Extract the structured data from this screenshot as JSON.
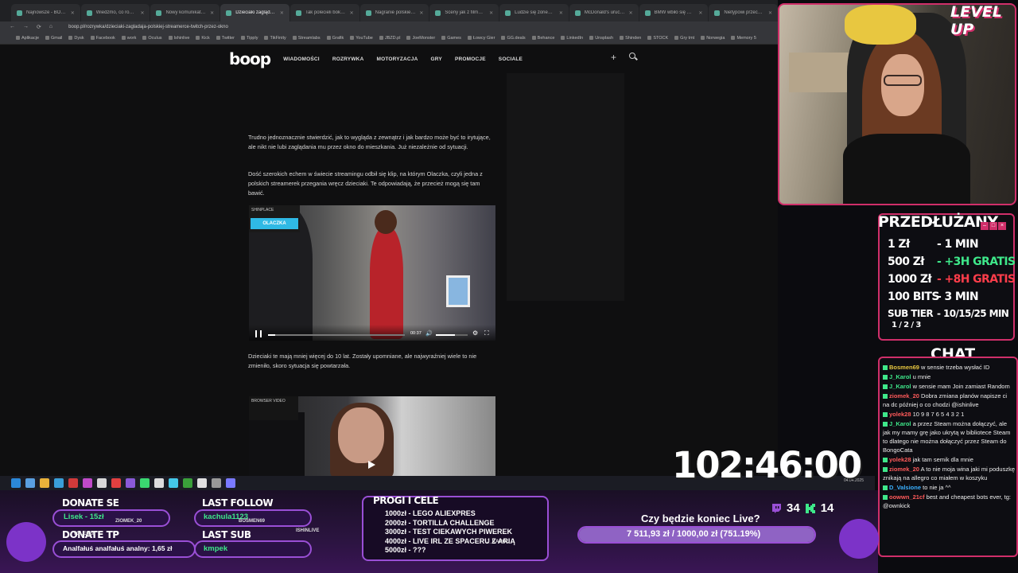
{
  "browser": {
    "tabs": [
      {
        "label": "Najnowsze - BOOP.PL",
        "active": false
      },
      {
        "label": "Wiedzmo, co robi prokuratura",
        "active": false
      },
      {
        "label": "Nowy komunikat prokuratury",
        "active": false
      },
      {
        "label": "Dzieciaki zaglądają przez okno",
        "active": true
      },
      {
        "label": "Tak polecieli bokiem, że",
        "active": false
      },
      {
        "label": "Nagranie polskiego influ",
        "active": false
      },
      {
        "label": "Sceny jak z filmu akcji w",
        "active": false
      },
      {
        "label": "Ludzie się zorientowali, że",
        "active": false
      },
      {
        "label": "McDonald's uruchomił ",
        "active": false
      },
      {
        "label": "BMW wbiło się w drzewo",
        "active": false
      },
      {
        "label": "Nietypowi przechodnie",
        "active": false
      }
    ],
    "url": "boop.pl/rozrywka/dzieciaki-zagladaja-polskiej-streamerce-twitch-przez-okno",
    "bookmarks": [
      "Aplikacje",
      "Gmail",
      "Dysk",
      "Facebook",
      "work",
      "Oculus",
      "Ishinlive",
      "Kick",
      "Twitter",
      "Tipply",
      "TikFinity",
      "Streamlabs",
      "Grafik",
      "YouTube",
      "JBZD.pl",
      "JoeMonster",
      "Games",
      "Łowcy Gier",
      "GG.deals",
      "Behance",
      "LinkedIn",
      "Unsplash",
      "Shinden",
      "STOCK",
      "Gry tmt",
      "Norwegia",
      "Memory 5"
    ]
  },
  "site": {
    "logo": "boop",
    "nav": [
      "WIADOMOŚCI",
      "ROZRYWKA",
      "MOTORYZACJA",
      "GRY",
      "PROMOCJE",
      "SOCIALE"
    ],
    "paragraphs": [
      "Trudno jednoznacznie stwierdzić, jak to wygląda z zewnątrz i jak bardzo może być to irytujące, ale nikt nie lubi zaglądania mu przez okno do mieszkania. Już niezależnie od sytuacji.",
      "Dość szerokich echem w świecie streamingu odbił się klip, na którym Olaczka, czyli jedna z polskich streamerek przegania wręcz dzieciaki. Te odpowiadają, że przecież mogą się tam bawić.",
      "Dzieciaki te mają mniej więcej do 10 lat. Zostały upomniane, ale najwyraźniej wiele to nie zmieniło, skoro sytuacja się powtarzała."
    ],
    "video1": {
      "badge_top": "SHINPLACE",
      "badge_label": "OLACZKA",
      "time": "00:37",
      "progress": 0.05,
      "volume": 0.6
    },
    "video2": {
      "badge_top": "BROWSER VIDEO"
    }
  },
  "overlay": {
    "brand": "LEVEL UP",
    "prices": {
      "title": "PRZEDŁUŻANY",
      "rows": [
        {
          "amount": "1 Zł",
          "value": "- 1 MIN",
          "color": "#ffffff"
        },
        {
          "amount": "500 Zł",
          "value": "- +3H GRATIS",
          "color": "#3ee88a"
        },
        {
          "amount": "1000 Zł",
          "value": "- +8H GRATIS",
          "color": "#ff3d4a"
        },
        {
          "amount": "100 BITS",
          "value": "- 3 MIN",
          "color": "#ffffff"
        },
        {
          "amount": "SUB TIER",
          "value": "- 10/15/25 MIN",
          "color": "#ffffff"
        }
      ],
      "tier_sub": "1 / 2 / 3"
    },
    "chat": {
      "title": "CHAT",
      "messages": [
        {
          "user": "Bosmen69",
          "color": "#e8c740",
          "text": " w sensie trzeba wysłać ID"
        },
        {
          "user": "J_Karol",
          "color": "#3ee88a",
          "text": " u mnie"
        },
        {
          "user": "J_Karol",
          "color": "#3ee88a",
          "text": " w sensie mam Join zamiast Random"
        },
        {
          "user": "ziomek_20",
          "color": "#ff5a5a",
          "text": " Dobra zmiana planów napisze ci na dc później o co chodzi @ishinlive"
        },
        {
          "user": "yolek28",
          "color": "#ff5a5a",
          "text": " 10 9 8 7 6 5 4 3 2 1"
        },
        {
          "user": "J_Karol",
          "color": "#3ee88a",
          "text": " a przez Steam można dołączyć, ale jak my mamy grę jako ukrytą w bibliotece Steam to dlatego nie można dołączyć przez Steam do BongoCata"
        },
        {
          "user": "yolek28",
          "color": "#ff5a5a",
          "text": " jak tam semik dla mnie"
        },
        {
          "user": "ziomek_20",
          "color": "#ff5a5a",
          "text": " A to nie moja wina jaki mi poduszkę znikają na allegro co miałem w koszyku"
        },
        {
          "user": "D_Valsione",
          "color": "#3ab0ff",
          "text": " to nie ja ^^"
        },
        {
          "user": "oowwn_21cf",
          "color": "#ff5a5a",
          "text": " best and cheapest bots ever, tg: @ownkick"
        }
      ]
    },
    "timer": "102:46:00",
    "donate_se": {
      "title": "DONATE SE",
      "name": "Lisek - 15zł",
      "by": "ZIOMEK_20"
    },
    "donate_tp": {
      "title": "DONATE TP",
      "name": "Analfałuś analfałuś analny: 1,65 zł",
      "by": "YOLEK28"
    },
    "last_follow": {
      "title": "LAST FOLLOW",
      "name": "kachula1123",
      "by": "BOSMEN69"
    },
    "last_sub": {
      "title": "LAST SUB",
      "name": "kmpek",
      "by": "ISHINLIVE"
    },
    "progi": {
      "title": "PROGI I CELE",
      "items": [
        "1000zł - LEGO ALIEXPRES",
        "2000zł - TORTILLA CHALLENGE",
        "3000zł - TEST CIEKAWYCH PIWEREK",
        "4000zł - LIVE IRL ZE SPACERU Z ARIĄ",
        "5000zł - ???"
      ],
      "tag": "J_KAROL"
    },
    "goal": {
      "question": "Czy będzie koniec Live?",
      "text": "7 511,93 zł / 1000,00 zł (751.19%)",
      "progress": 1.0
    },
    "subs": {
      "subs_count": "34",
      "kick_count": "14"
    },
    "colors": {
      "accent": "#d02f6a",
      "purple": "#9a4fd6",
      "green": "#3ee88a",
      "red": "#ff3d4a"
    }
  },
  "taskbar": {
    "time": "04.04.2025"
  }
}
